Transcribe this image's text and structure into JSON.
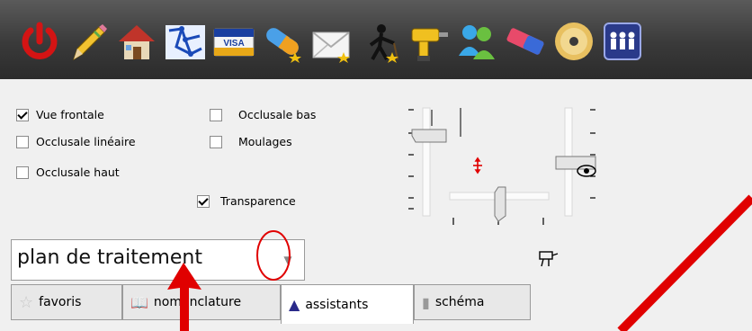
{
  "toolbar": {
    "icons": [
      "power-icon",
      "pencil-icon",
      "home-icon",
      "network-icon",
      "visa-card-icon",
      "pill-icon",
      "mail-icon",
      "worker-icon",
      "drill-icon",
      "users-icon",
      "eraser-icon",
      "disc-icon",
      "team-icon"
    ],
    "visa_text": "VISA"
  },
  "options": {
    "vue_frontale": "Vue frontale",
    "occlusale_lineaire": "Occlusale linéaire",
    "occlusale_haut": "Occlusale haut",
    "occlusale_bas": "Occlusale bas",
    "moulages": "Moulages",
    "transparence": "Transparence"
  },
  "combo": {
    "value": "plan de traitement"
  },
  "tabs": {
    "favoris": "favoris",
    "nomenclature": "nomenclature",
    "assistants": "assistants",
    "schema": "schéma"
  },
  "colors": {
    "annotation": "#e00000"
  }
}
